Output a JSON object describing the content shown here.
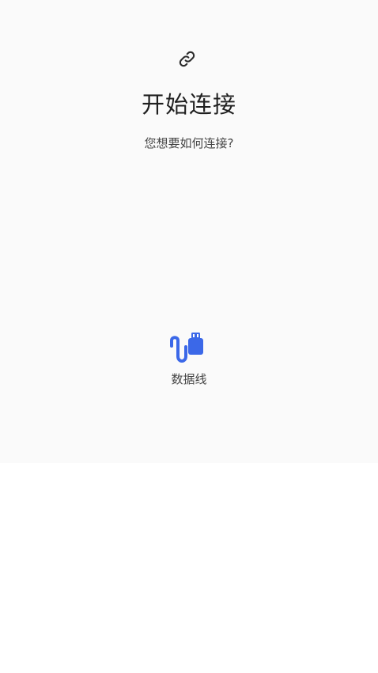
{
  "header": {
    "icon": "link-icon",
    "title": "开始连接",
    "subtitle": "您想要如何连接?"
  },
  "options": [
    {
      "icon": "usb-cable-icon",
      "label": "数据线"
    }
  ],
  "colors": {
    "background_top": "#fafafa",
    "background_bottom": "#ffffff",
    "text_primary": "#1f1f1f",
    "text_secondary": "#444444",
    "accent_blue": "#3b68e8"
  }
}
